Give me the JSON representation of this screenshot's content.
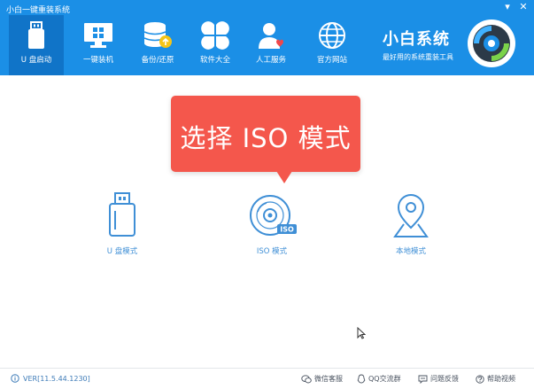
{
  "window": {
    "title": "小白一键重装系统",
    "minimize_glyph": "▾",
    "close_glyph": "✕"
  },
  "nav": [
    {
      "label": "U 盘启动",
      "icon": "usb-drive-icon",
      "active": true
    },
    {
      "label": "一键装机",
      "icon": "monitor-windows-icon",
      "active": false
    },
    {
      "label": "备份/还原",
      "icon": "database-backup-icon",
      "active": false
    },
    {
      "label": "软件大全",
      "icon": "clover-apps-icon",
      "active": false
    },
    {
      "label": "人工服务",
      "icon": "person-heart-icon",
      "active": false
    },
    {
      "label": "官方网站",
      "icon": "globe-icon",
      "active": false
    }
  ],
  "brand": {
    "title": "小白系统",
    "subtitle": "最好用的系统重装工具"
  },
  "tooltip": {
    "text": "选择 ISO 模式"
  },
  "modes": [
    {
      "label": "U 盘模式",
      "icon": "usb-drive-icon"
    },
    {
      "label": "ISO 模式",
      "icon": "iso-disc-icon",
      "badge": "ISO"
    },
    {
      "label": "本地模式",
      "icon": "map-pin-icon"
    }
  ],
  "footer": {
    "version": "VER[11.5.44.1230]",
    "links": [
      {
        "label": "微信客服",
        "icon": "wechat-icon"
      },
      {
        "label": "QQ交流群",
        "icon": "qq-icon"
      },
      {
        "label": "问题反馈",
        "icon": "feedback-icon"
      },
      {
        "label": "帮助视频",
        "icon": "help-icon"
      }
    ]
  },
  "colors": {
    "header": "#1b8fe6",
    "active_tab": "#1074c8",
    "tooltip": "#f4574c",
    "mode_icon": "#3f8fd6"
  }
}
